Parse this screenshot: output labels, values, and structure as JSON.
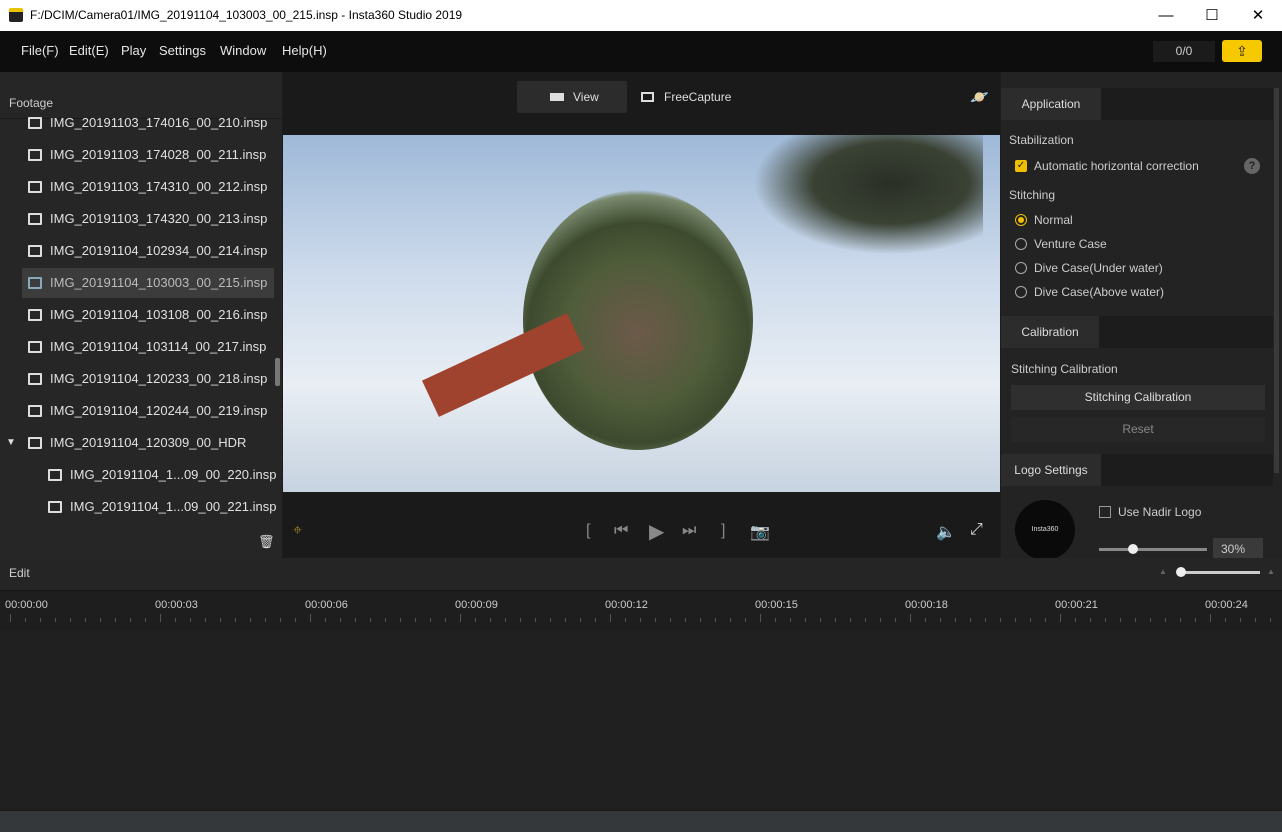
{
  "window": {
    "title": "F:/DCIM/Camera01/IMG_20191104_103003_00_215.insp - Insta360 Studio 2019",
    "controls": [
      "—",
      "☐",
      "✕"
    ]
  },
  "menu": [
    "File(F)",
    "Edit(E)",
    "Play",
    "Settings",
    "Window",
    "Help(H)"
  ],
  "toolbar": {
    "counter": "0/0",
    "export_icon": "upload-icon"
  },
  "footage": {
    "title": "Footage",
    "items": [
      {
        "label": "IMG_20191103_174016_00_210.insp"
      },
      {
        "label": "IMG_20191103_174028_00_211.insp"
      },
      {
        "label": "IMG_20191103_174310_00_212.insp"
      },
      {
        "label": "IMG_20191103_174320_00_213.insp"
      },
      {
        "label": "IMG_20191104_102934_00_214.insp"
      },
      {
        "label": "IMG_20191104_103003_00_215.insp",
        "selected": true
      },
      {
        "label": "IMG_20191104_103108_00_216.insp"
      },
      {
        "label": "IMG_20191104_103114_00_217.insp"
      },
      {
        "label": "IMG_20191104_120233_00_218.insp"
      },
      {
        "label": "IMG_20191104_120244_00_219.insp"
      },
      {
        "label": "IMG_20191104_120309_00_HDR",
        "group": true
      },
      {
        "label": "IMG_20191104_1...09_00_220.insp",
        "child": true
      },
      {
        "label": "IMG_20191104_1...09_00_221.insp",
        "child": true
      }
    ]
  },
  "viewer": {
    "view_label": "View",
    "freecapture_label": "FreeCapture"
  },
  "right": {
    "application_tab": "Application",
    "stabilization": "Stabilization",
    "auto_horizontal": "Automatic horizontal correction",
    "auto_horizontal_checked": true,
    "stitching": "Stitching",
    "stitching_options": [
      "Normal",
      "Venture Case",
      "Dive Case(Under water)",
      "Dive Case(Above water)"
    ],
    "stitching_selected": "Normal",
    "calibration_tab": "Calibration",
    "stitching_calibration_label": "Stitching Calibration",
    "stitching_calibration_button": "Stitching Calibration",
    "reset_button": "Reset",
    "logo_tab": "Logo Settings",
    "use_nadir_logo": "Use Nadir Logo",
    "logo_brand": "Insta360",
    "logo_size": "30%"
  },
  "edit": {
    "label": "Edit",
    "timecodes": [
      "00:00:00",
      "00:00:03",
      "00:00:06",
      "00:00:09",
      "00:00:12",
      "00:00:15",
      "00:00:18",
      "00:00:21",
      "00:00:24"
    ]
  },
  "colors": {
    "accent": "#f5c800"
  }
}
